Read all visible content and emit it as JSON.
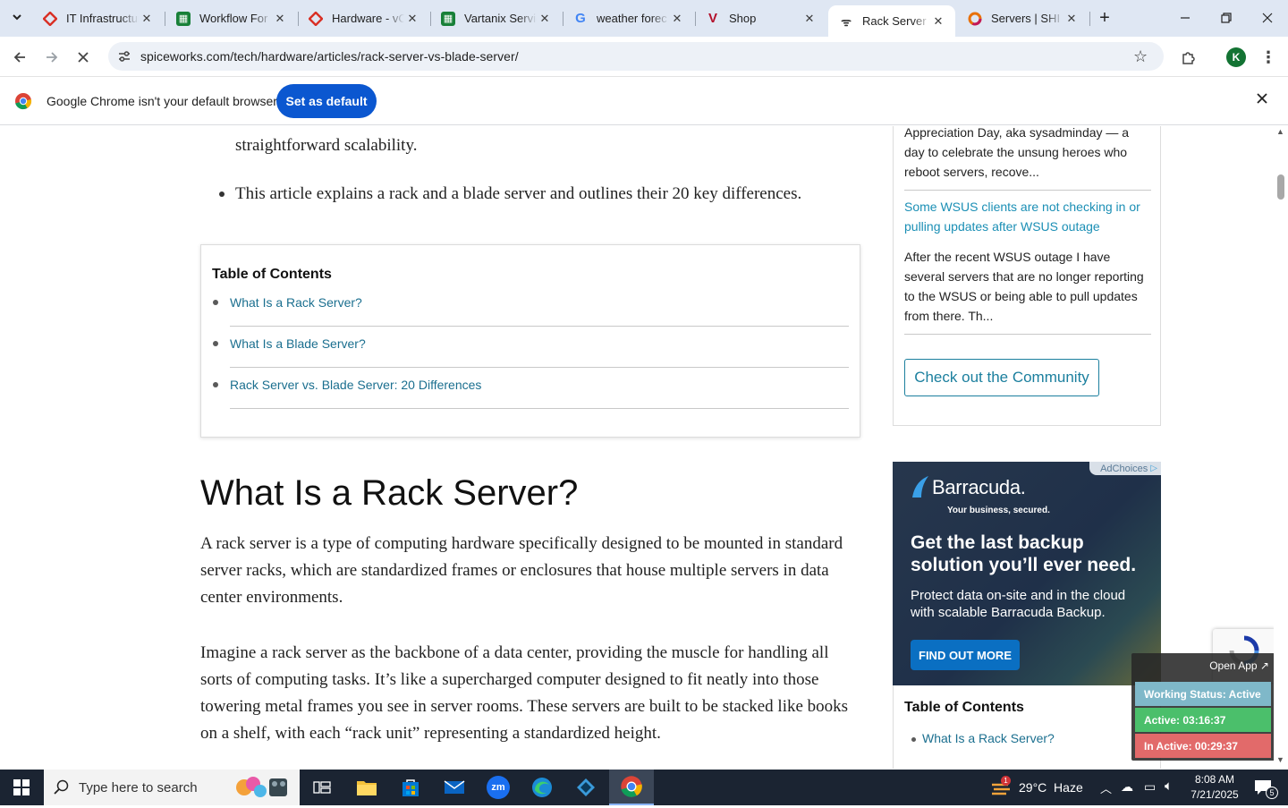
{
  "tabs": [
    {
      "title": "IT Infrastructure",
      "icon": "red-diamond-favicon",
      "color": "#d93025"
    },
    {
      "title": "Workflow For",
      "icon": "sheets-favicon",
      "color": "#188038"
    },
    {
      "title": "Hardware - vC",
      "icon": "red-diamond-favicon",
      "color": "#d93025"
    },
    {
      "title": "Vartanix Servic",
      "icon": "sheets-favicon",
      "color": "#188038"
    },
    {
      "title": "weather forec",
      "icon": "google-favicon",
      "color": "#4285f4"
    },
    {
      "title": "Shop",
      "icon": "v-favicon",
      "color": "#b3102b"
    },
    {
      "title": "Rack Server vs",
      "icon": "spiceworks-favicon",
      "color": "#444444",
      "active": true
    },
    {
      "title": "Servers | SHI",
      "icon": "shi-favicon",
      "color": "#e8710a"
    }
  ],
  "toolbar": {
    "url": "spiceworks.com/tech/hardware/articles/rack-server-vs-blade-server/",
    "profile_initial": "K"
  },
  "infobar": {
    "message": "Google Chrome isn't your default browser",
    "button": "Set as default"
  },
  "article": {
    "partial_bullet": "straightforward scalability.",
    "bullet": "This article explains a rack and a blade server and outlines their 20 key differences.",
    "toc_title": "Table of Contents",
    "toc_items": [
      "What Is a Rack Server?",
      "What Is a Blade Server?",
      "Rack Server vs. Blade Server: 20 Differences"
    ],
    "heading": "What Is a Rack Server?",
    "para1": "A rack server is a type of computing hardware specifically designed to be mounted in standard server racks, which are standardized frames or enclosures that house multiple servers in data center environments.",
    "para2": "Imagine a rack server as the backbone of a data center, providing the muscle for handling all sorts of computing tasks. It’s like a supercharged computer designed to fit neatly into those towering metal frames you see in server rooms. These servers are built to be stacked like books on a shelf, with each “rack unit” representing a standardized height."
  },
  "sidebar": {
    "snippet1": "Appreciation Day, aka sysadminday — a day to celebrate the unsung heroes who reboot servers, recove...",
    "link2": "Some WSUS clients are not checking in or pulling updates after WSUS outage",
    "snippet2": "After the recent WSUS outage I have several servers that are no longer reporting to the WSUS or being able to pull updates from there. Th...",
    "community_button": "Check out the Community",
    "toc_title": "Table of Contents",
    "toc_item": "What Is a Rack Server?"
  },
  "ad": {
    "adchoices": "AdChoices",
    "brand": "Barracuda.",
    "tagline": "Your business, secured.",
    "headline": "Get the last backup solution you’ll ever need.",
    "body": "Protect data on-site and in the cloud with scalable Barracuda Backup.",
    "cta": "FIND OUT MORE"
  },
  "tracker": {
    "open_app": "Open App ↗",
    "status": "Working Status: Active",
    "active": "Active: 03:16:37",
    "inactive": "In Active: 00:29:37",
    "colors": {
      "status": "#7fb8c9",
      "active": "#4bbf6b",
      "inactive": "#e26a6a"
    }
  },
  "taskbar": {
    "search_placeholder": "Type here to search",
    "weather": "29°C  Haze",
    "time": "8:08 AM",
    "date": "7/21/2025",
    "notifications": "5",
    "weather_badge": "1"
  }
}
